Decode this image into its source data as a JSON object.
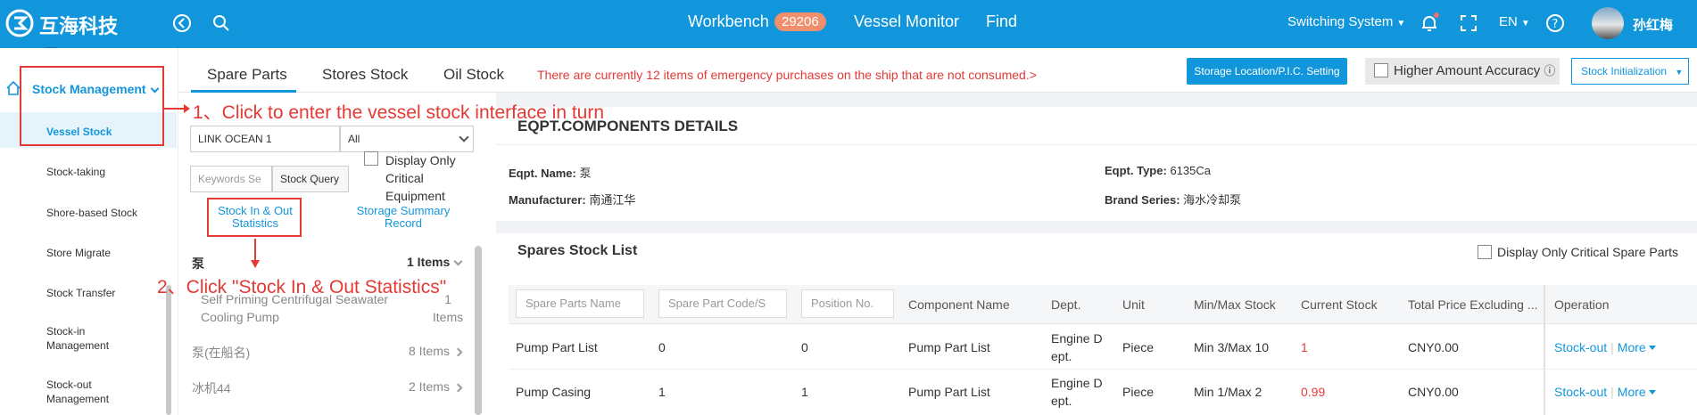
{
  "header": {
    "brand": "互海科技",
    "nav": [
      "Workbench",
      "Vessel Monitor",
      "Find"
    ],
    "workbench_badge": "29206",
    "switching": "Switching System",
    "language": "EN",
    "username": "孙红梅",
    "icons": [
      "logo-icon",
      "back-icon",
      "search-icon",
      "bell-icon",
      "fullscreen-icon",
      "help-icon"
    ]
  },
  "sidebar": {
    "group": "Stock Management",
    "items": [
      {
        "label": "Vessel Stock",
        "active": true
      },
      {
        "label": "Stock-taking"
      },
      {
        "label": "Shore-based Stock"
      },
      {
        "label": "Store Migrate"
      },
      {
        "label": "Stock Transfer"
      },
      {
        "label": "Stock-in Management"
      },
      {
        "label": "Stock-out Management"
      }
    ]
  },
  "tabs": [
    "Spare Parts",
    "Stores Stock",
    "Oil Stock"
  ],
  "warning": "There are currently 12 items of emergency purchases on the ship that are not consumed.>",
  "toolbar": {
    "storage_btn": "Storage Location/P.I.C. Setting",
    "accuracy": "Higher Amount Accuracy",
    "stock_init": "Stock Initialization"
  },
  "filters": {
    "vessel": "LINK OCEAN 1",
    "all": "All",
    "keywords_placeholder": "Keywords Se",
    "stock_query": "Stock Query",
    "display_critical": "Display Only Critical Equipment",
    "stock_in_out": "Stock In & Out Statistics",
    "storage_summary": "Storage Summary Record"
  },
  "tree": {
    "root_label": "泵",
    "root_count": "1 Items",
    "child_label": "Self Priming Centrifugal Seawater Cooling Pump",
    "child_count": "1 Items",
    "rows": [
      {
        "label": "泵(在船名)",
        "count": "8 Items"
      },
      {
        "label": "冰机44",
        "count": "2 Items"
      }
    ]
  },
  "annotations": {
    "step1": "1、Click to enter the vessel stock interface in turn",
    "step2": "2、Click \"Stock In & Out  Statistics\""
  },
  "details": {
    "title": "EQPT.COMPONENTS DETAILS",
    "eqpt_name_label": "Eqpt. Name:",
    "eqpt_name": "泵",
    "eqpt_type_label": "Eqpt. Type:",
    "eqpt_type": "6135Ca",
    "manufacturer_label": "Manufacturer:",
    "manufacturer": "南通江华",
    "brand_series_label": "Brand Series:",
    "brand_series": "海水冷却泵"
  },
  "spares": {
    "title": "Spares Stock List",
    "critical_only": "Display Only Critical Spare Parts",
    "filters": [
      "Spare Parts Name",
      "Spare Part Code/S",
      "Position No."
    ],
    "columns": [
      "Component Name",
      "Dept.",
      "Unit",
      "Min/Max Stock",
      "Current Stock",
      "Total Price Excluding ...",
      "Operation"
    ],
    "rows": [
      {
        "name": "Pump Part List",
        "code": "0",
        "position": "0",
        "component": "Pump Part List",
        "dept": "Engine Dept.",
        "unit": "Piece",
        "minmax": "Min 3/Max 10",
        "current": "1",
        "price": "CNY0.00",
        "op": "Stock-out",
        "more": "More"
      },
      {
        "name": "Pump Casing",
        "code": "1",
        "position": "1",
        "component": "Pump Part List",
        "dept": "Engine Dept.",
        "unit": "Piece",
        "minmax": "Min 1/Max 2",
        "current": "0.99",
        "price": "CNY0.00",
        "op": "Stock-out",
        "more": "More"
      }
    ]
  },
  "colors": {
    "primary": "#1296db",
    "danger": "#e53935",
    "badge": "#ef8f6e"
  }
}
